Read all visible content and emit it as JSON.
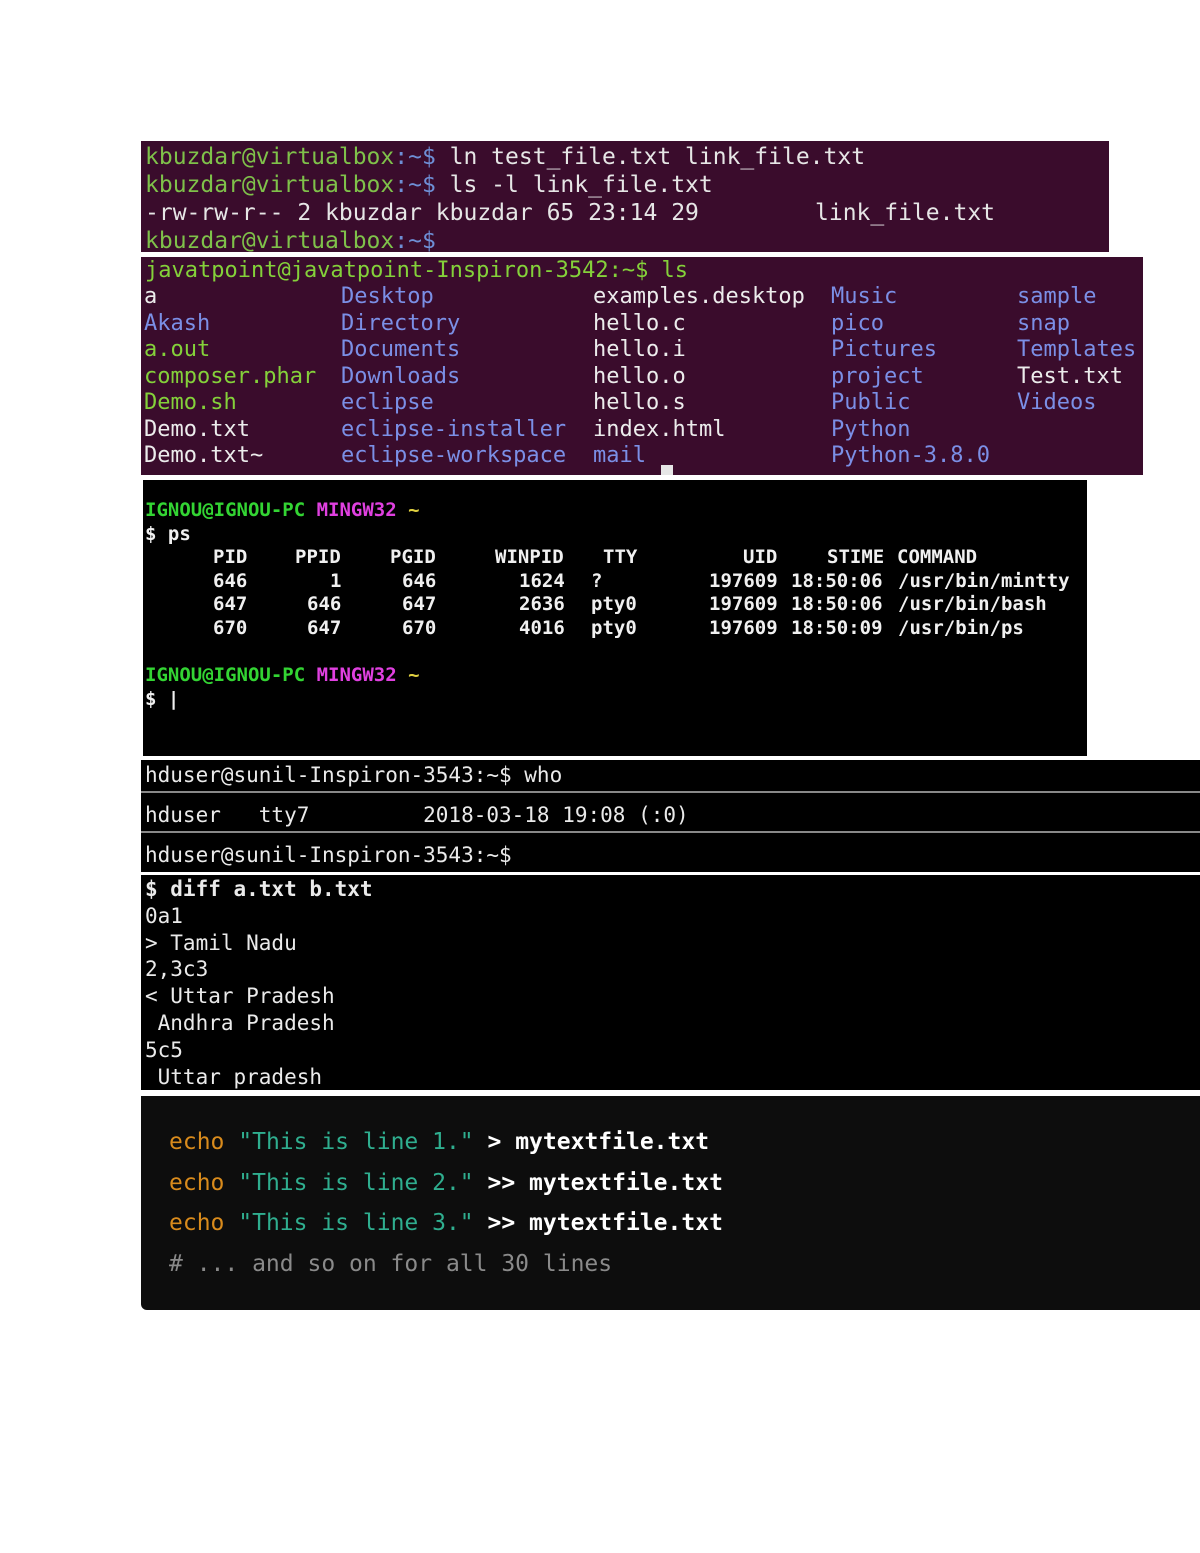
{
  "t1": {
    "prompt_user": "kbuzdar@virtualbox",
    "prompt_path": ":~$",
    "cmd1": " ln test_file.txt link_file.txt",
    "cmd2": " ls -l link_file.txt",
    "output": "-rw-rw-r-- 2 kbuzdar kbuzdar 65 23:14 29",
    "output_file": "link_file.txt"
  },
  "t2": {
    "prompt": "javatpoint@javatpoint-Inspiron-3542:~$ ls",
    "col1": [
      "a",
      "Akash",
      "a.out",
      "composer.phar",
      "Demo.sh",
      "Demo.txt",
      "Demo.txt~"
    ],
    "col2": [
      "Desktop",
      "Directory",
      "Documents",
      "Downloads",
      "eclipse",
      "eclipse-installer",
      "eclipse-workspace"
    ],
    "col3": [
      "examples.desktop",
      "hello.c",
      "hello.i",
      "hello.o",
      "hello.s",
      "index.html",
      "mail"
    ],
    "col4": [
      "Music",
      "pico",
      "Pictures",
      "project",
      "Public",
      "Python",
      "Python-3.8.0"
    ],
    "col5": [
      "sample",
      "snap",
      "Templates",
      "Test.txt",
      "Videos"
    ]
  },
  "t3": {
    "host": "IGNOU@IGNOU-PC",
    "env": "MINGW32",
    "tilde": "~",
    "cmd": "$ ps",
    "headers": [
      "PID",
      "PPID",
      "PGID",
      "WINPID",
      "TTY",
      "UID",
      "STIME",
      "COMMAND"
    ],
    "rows": [
      [
        "646",
        "1",
        "646",
        "1624",
        "?",
        "197609",
        "18:50:06",
        "/usr/bin/mintty"
      ],
      [
        "647",
        "646",
        "647",
        "2636",
        "pty0",
        "197609",
        "18:50:06",
        "/usr/bin/bash"
      ],
      [
        "670",
        "647",
        "670",
        "4016",
        "pty0",
        "197609",
        "18:50:09",
        "/usr/bin/ps"
      ]
    ],
    "prompt2": "$ |"
  },
  "t4": {
    "line1": "hduser@sunil-Inspiron-3543:~$ who",
    "line2": "hduser   tty7         2018-03-18 19:08 (:0)",
    "line3": "hduser@sunil-Inspiron-3543:~$"
  },
  "t5": {
    "lines": [
      "$ diff a.txt b.txt",
      "0a1",
      "> Tamil Nadu",
      "2,3c3",
      "< Uttar Pradesh",
      " Andhra Pradesh",
      "5c5",
      " Uttar pradesh"
    ]
  },
  "t6": {
    "keyword": "echo",
    "str1": "\"This is line 1.\"",
    "str2": "\"This is line 2.\"",
    "str3": "\"This is line 3.\"",
    "op1": "> mytextfile.txt",
    "op2": ">> mytextfile.txt",
    "op3": ">> mytextfile.txt",
    "comment": "# ... and so on for all 30 lines"
  }
}
